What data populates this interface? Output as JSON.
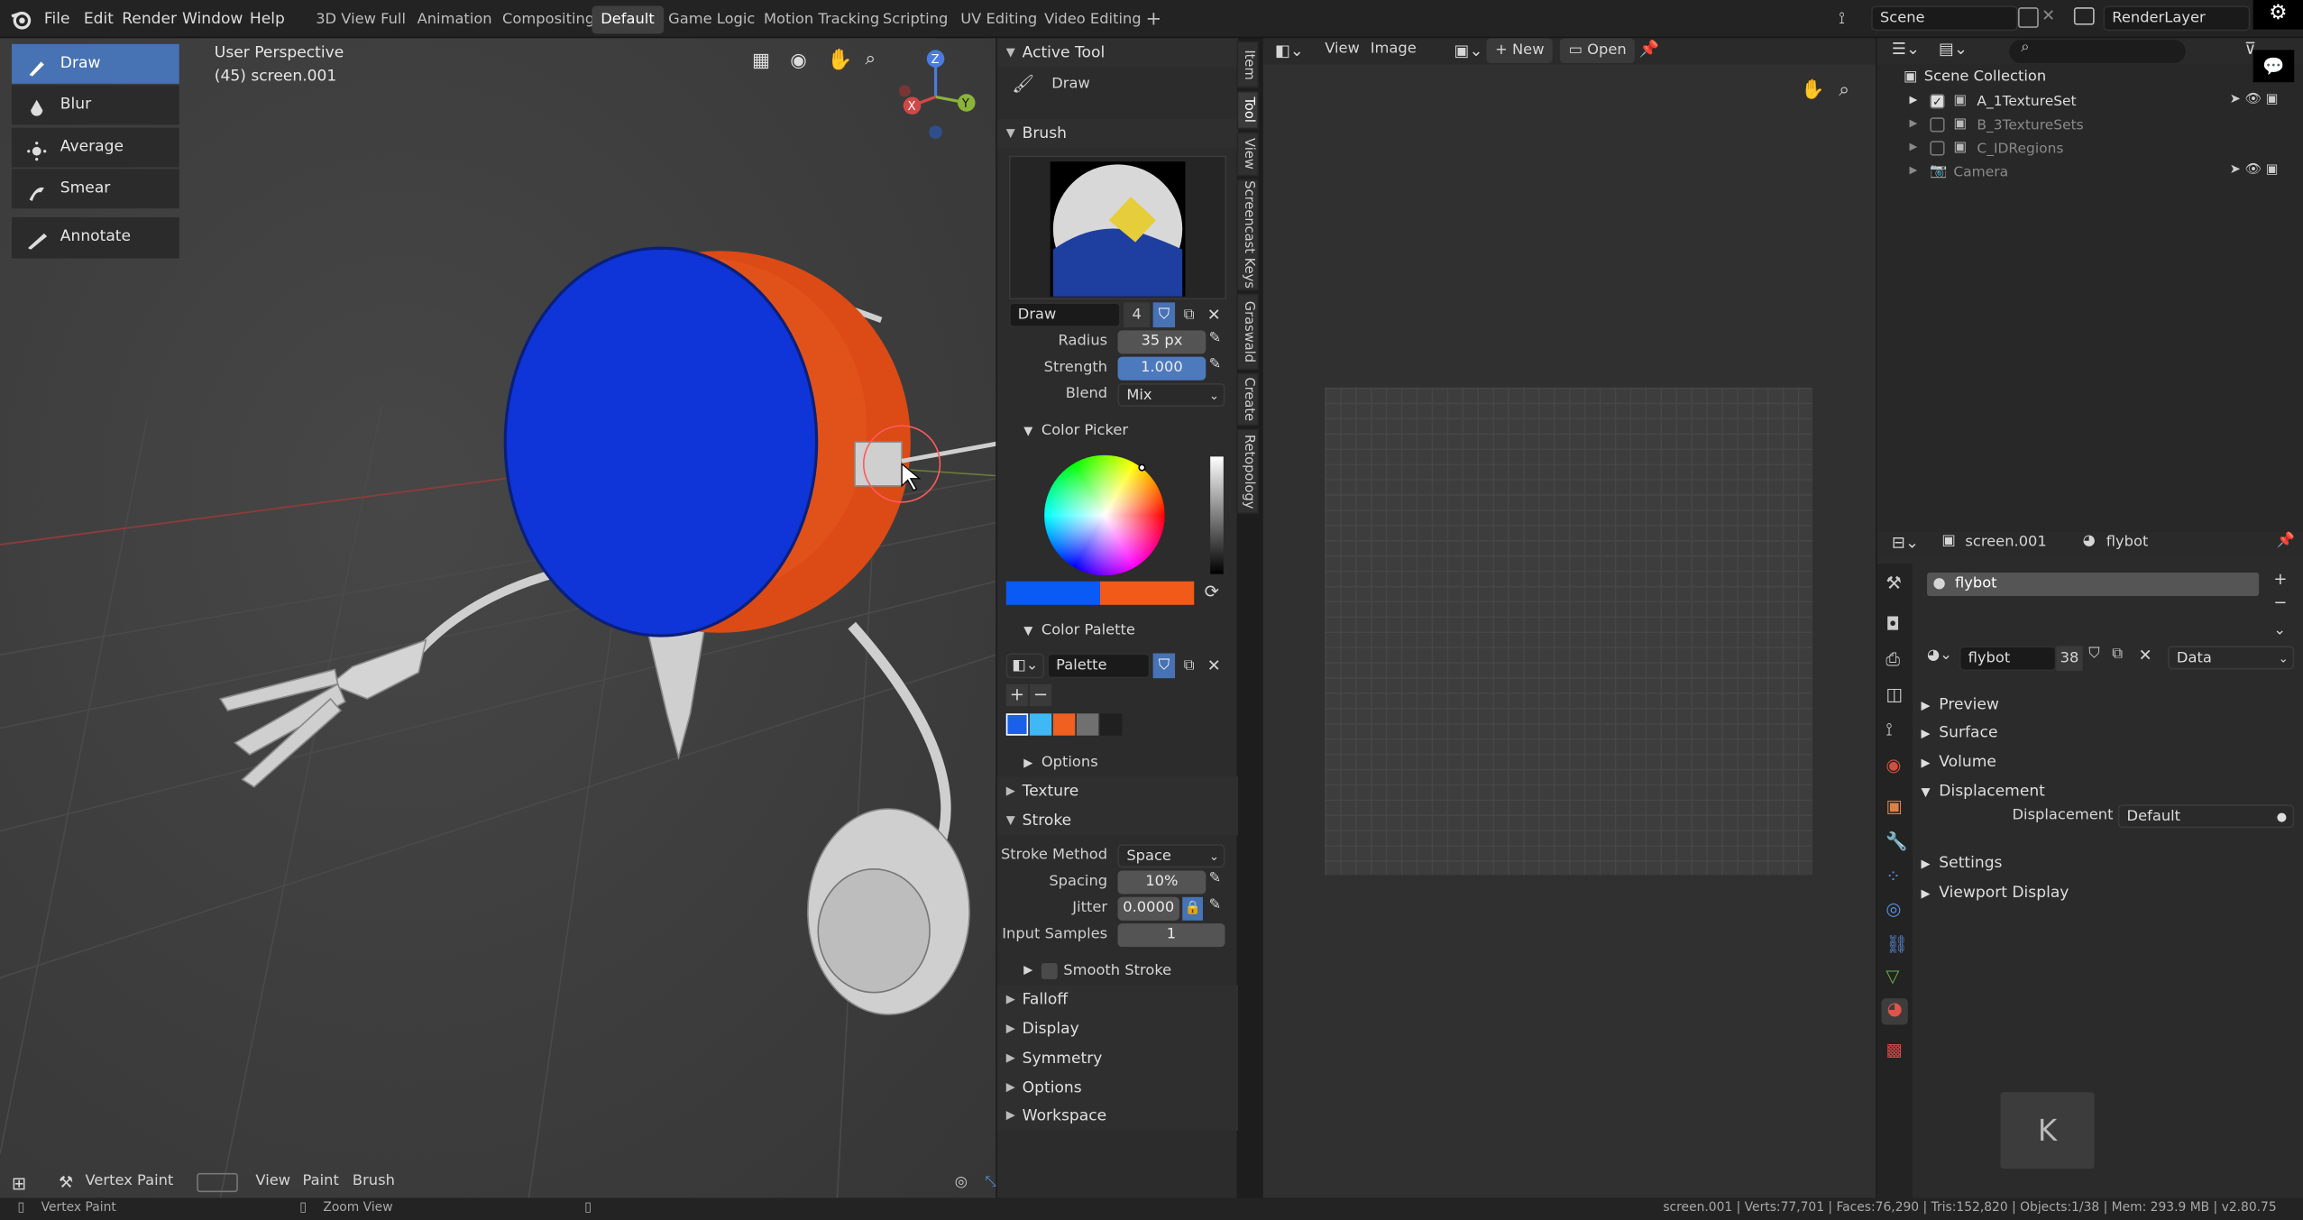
{
  "topbar": {
    "menus": [
      "File",
      "Edit",
      "Render",
      "Window",
      "Help"
    ],
    "workspaces": [
      "3D View Full",
      "Animation",
      "Compositing",
      "Default",
      "Game Logic",
      "Motion Tracking",
      "Scripting",
      "UV Editing",
      "Video Editing"
    ],
    "active_workspace": "Default",
    "scene": "Scene",
    "render_layer": "RenderLayer"
  },
  "viewport": {
    "overlay_title": "User Perspective",
    "overlay_subtitle": "(45) screen.001",
    "tools": [
      "Draw",
      "Blur",
      "Average",
      "Smear",
      "Annotate"
    ],
    "active_tool": "Draw",
    "gizmo": {
      "x": "X",
      "y": "Y",
      "z": "Z"
    },
    "header": {
      "mode": "Vertex Paint",
      "menus": [
        "View",
        "Paint",
        "Brush"
      ]
    }
  },
  "sidebar": {
    "tabs": [
      "Item",
      "Tool",
      "View",
      "Screencast Keys",
      "Graswald",
      "Create",
      "Retopology"
    ],
    "active_tool_header": "Active Tool",
    "active_tool_name": "Draw",
    "brush_header": "Brush",
    "brush_name": "Draw",
    "brush_users": "4",
    "radius_label": "Radius",
    "radius_value": "35 px",
    "strength_label": "Strength",
    "strength_value": "1.000",
    "blend_label": "Blend",
    "blend_value": "Mix",
    "color_picker_header": "Color Picker",
    "primary_color": "#0a5af5",
    "secondary_color": "#f25a1a",
    "palette_header": "Color Palette",
    "palette_name": "Palette",
    "palette_swatches": [
      "#1a60e8",
      "#40b8f5",
      "#f06020",
      "#707070",
      "#202020"
    ],
    "options_sub": "Options",
    "texture_header": "Texture",
    "stroke_header": "Stroke",
    "stroke_method_label": "Stroke Method",
    "stroke_method_value": "Space",
    "spacing_label": "Spacing",
    "spacing_value": "10%",
    "jitter_label": "Jitter",
    "jitter_value": "0.0000",
    "input_samples_label": "Input Samples",
    "input_samples_value": "1",
    "smooth_stroke_label": "Smooth Stroke",
    "falloff_header": "Falloff",
    "display_header": "Display",
    "symmetry_header": "Symmetry",
    "options_header": "Options",
    "workspace_header": "Workspace"
  },
  "image_editor": {
    "menus": [
      "View",
      "Image"
    ],
    "new_label": "New",
    "open_label": "Open"
  },
  "outliner": {
    "root": "Scene Collection",
    "items": [
      {
        "label": "A_1TextureSet",
        "checked": true
      },
      {
        "label": "B_3TextureSets",
        "checked": false
      },
      {
        "label": "C_IDRegions",
        "checked": false
      },
      {
        "label": "Camera",
        "checked": false
      }
    ]
  },
  "properties": {
    "object_name": "screen.001",
    "material_name": "flybot",
    "slot_name": "flybot",
    "material_users": "38",
    "link_value": "Data",
    "sections": [
      "Preview",
      "Surface",
      "Volume",
      "Displacement",
      "Settings",
      "Viewport Display"
    ],
    "displacement_label": "Displacement",
    "displacement_value": "Default",
    "key_overlay": "K"
  },
  "statusbar": {
    "left": "Vertex Paint",
    "middle": "Zoom View",
    "stats": "screen.001 | Verts:77,701 | Faces:76,290 | Tris:152,820 | Objects:1/38 | Mem: 293.9 MB | v2.80.75"
  }
}
